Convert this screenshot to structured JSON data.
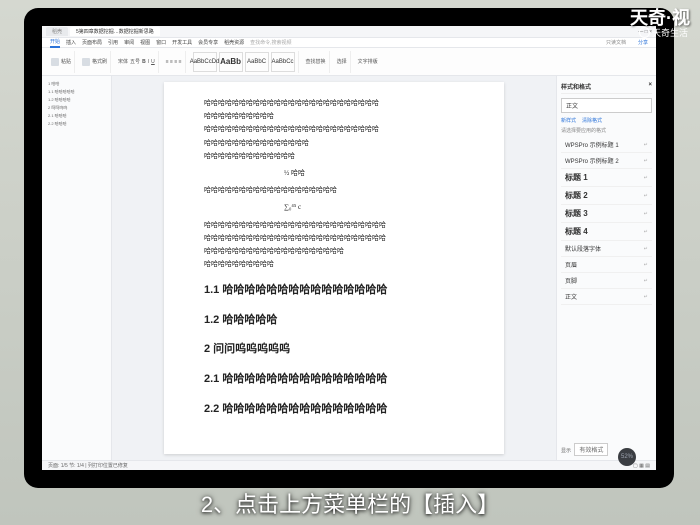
{
  "watermark": {
    "brand": "天奇·视",
    "sub": "天奇生活"
  },
  "caption": "2、点击上方菜单栏的【插入】",
  "titlebar": {
    "tab1": "稻壳",
    "tab2": "5第四章数据挖掘…数据挖掘新思路",
    "win_controls": "— □ ×"
  },
  "ribbon_tabs": [
    "开始",
    "插入",
    "页面布局",
    "引用",
    "审阅",
    "视图",
    "窗口",
    "开发工具",
    "会员专享",
    "稻壳资源",
    "查找命令,搜索视频"
  ],
  "ribbon_right": [
    "只读文档",
    "分享"
  ],
  "ribbon": {
    "paste": "粘贴",
    "format_painter": "格式刷",
    "font": "宋体",
    "font_size": "五号",
    "style_normal": "AaBbCcDd",
    "style_h1": "AaBb",
    "style_h2": "AaBbC",
    "style_h3": "AaBbCc",
    "find": "查找替换",
    "select": "选择",
    "tools": "文字排版"
  },
  "outline": [
    "1 哈哈",
    "1.1 哈哈哈哈哈",
    "1.2 哈哈哈哈",
    "2 呵呵呜呜",
    "2.1 哈哈哈",
    "2.2 哈哈哈"
  ],
  "document": {
    "paras_top": [
      "哈哈哈哈哈哈哈哈哈哈哈哈哈哈哈哈哈哈哈哈哈哈哈哈哈",
      "哈哈哈哈哈哈哈哈哈哈",
      "哈哈哈哈哈哈哈哈哈哈哈哈哈哈哈哈哈哈哈哈哈哈哈哈哈",
      "哈哈哈哈哈哈哈哈哈哈哈哈哈哈哈",
      "哈哈哈哈哈哈哈哈哈哈哈哈哈"
    ],
    "eq1": "½ 哈哈",
    "paras_mid": [
      "哈哈哈哈哈哈哈哈哈哈哈哈哈哈哈哈哈哈哈"
    ],
    "eq2": "∑₀⁴⁵ c",
    "paras_mid2": [
      "哈哈哈哈哈哈哈哈哈哈哈哈哈哈哈哈哈哈哈哈哈哈哈哈哈哈",
      "哈哈哈哈哈哈哈哈哈哈哈哈哈哈哈哈哈哈哈哈哈哈哈哈哈哈",
      "哈哈哈哈哈哈哈哈哈哈哈哈哈哈哈哈哈哈哈哈",
      "哈哈哈哈哈哈哈哈哈哈"
    ],
    "h11": "1.1 哈哈哈哈哈哈哈哈哈哈哈哈哈哈哈",
    "h12": "1.2 哈哈哈哈哈",
    "h2": "2 问问呜呜呜呜呜",
    "h21": "2.1 哈哈哈哈哈哈哈哈哈哈哈哈哈哈哈",
    "h22": "2.2 哈哈哈哈哈哈哈哈哈哈哈哈哈哈哈"
  },
  "style_pane": {
    "title": "样式和格式",
    "current": "正文",
    "tabs": [
      "新样式",
      "清除格式"
    ],
    "hint": "请选择要应用的格式",
    "items": [
      {
        "name": "WPSPro 示例标题 1",
        "cls": ""
      },
      {
        "name": "WPSPro 示例标题 2",
        "cls": ""
      },
      {
        "name": "标题 1",
        "cls": "title1"
      },
      {
        "name": "标题 2",
        "cls": "title2"
      },
      {
        "name": "标题 3",
        "cls": "title3"
      },
      {
        "name": "标题 4",
        "cls": "title4"
      },
      {
        "name": "默认段落字体",
        "cls": ""
      },
      {
        "name": "页眉",
        "cls": ""
      },
      {
        "name": "页脚",
        "cls": ""
      },
      {
        "name": "正文",
        "cls": ""
      }
    ],
    "footer_label": "显示",
    "footer_value": "有效格式"
  },
  "status": {
    "left": "页面: 1/5  节: 1/4  |  列打印位置已修复",
    "zoom": "52%"
  }
}
